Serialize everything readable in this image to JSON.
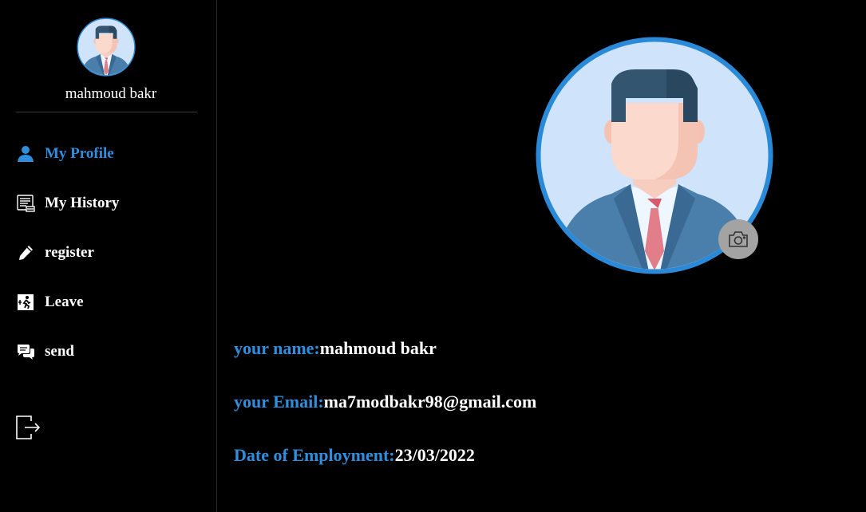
{
  "sidebar": {
    "user_name": "mahmoud bakr",
    "items": [
      {
        "label": "My Profile",
        "icon": "user-icon",
        "active": true
      },
      {
        "label": "My History",
        "icon": "history-icon",
        "active": false
      },
      {
        "label": "register",
        "icon": "pen-icon",
        "active": false
      },
      {
        "label": "Leave",
        "icon": "exit-door-icon",
        "active": false
      },
      {
        "label": "send",
        "icon": "chat-icon",
        "active": false
      }
    ],
    "logout_icon": "logout-icon"
  },
  "profile": {
    "name_label": "your name:",
    "name_value": "mahmoud bakr",
    "email_label": "your Email:",
    "email_value": "ma7modbakr98@gmail.com",
    "date_label": "Date of Employment:",
    "date_value": "23/03/2022",
    "camera_icon": "camera-icon"
  },
  "colors": {
    "accent": "#2f8fde",
    "background": "#000000",
    "text": "#ffffff",
    "camera_button": "#a3a3a3"
  }
}
